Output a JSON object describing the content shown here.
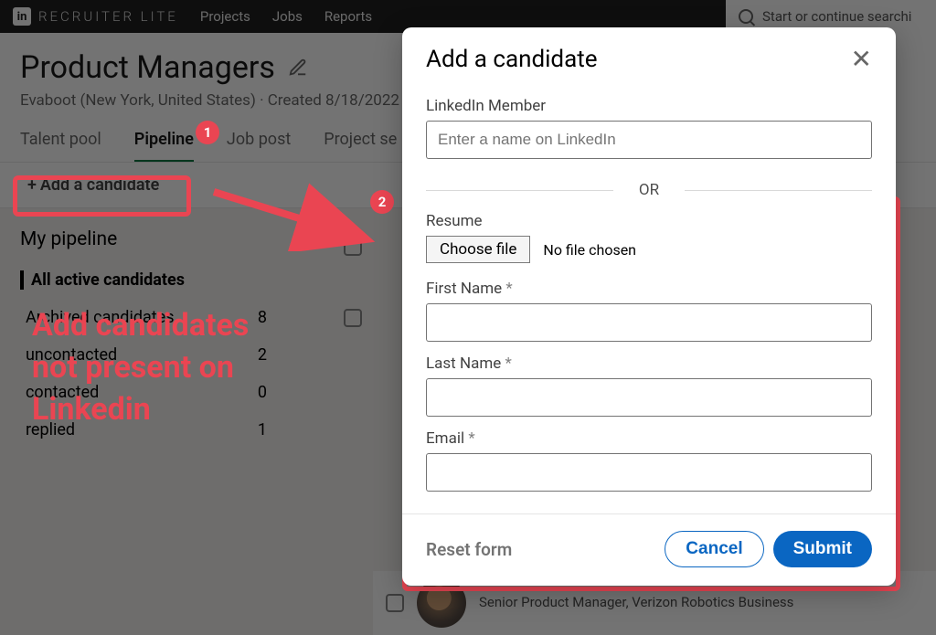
{
  "nav": {
    "logo_badge": "in",
    "logo_text": "RECRUITER LITE",
    "links": [
      "Projects",
      "Jobs",
      "Reports"
    ],
    "search_placeholder": "Start or continue searchi"
  },
  "project": {
    "title": "Product Managers",
    "subtitle": "Evaboot (New York, United States) · Created 8/18/2022",
    "tabs": [
      "Talent pool",
      "Pipeline",
      "Job post",
      "Project se"
    ],
    "active_tab": 1,
    "add_candidate_label": "Add a candidate"
  },
  "pipeline": {
    "heading": "My pipeline",
    "rows": [
      {
        "label": "All active candidates",
        "count": "",
        "bold": true
      },
      {
        "label": "Archived candidates",
        "count": "8"
      },
      {
        "label": "uncontacted",
        "count": "2"
      },
      {
        "label": "contacted",
        "count": "0"
      },
      {
        "label": "replied",
        "count": "1"
      }
    ]
  },
  "modal": {
    "title": "Add a candidate",
    "linkedin_label": "LinkedIn Member",
    "linkedin_placeholder": "Enter a name on LinkedIn",
    "or": "OR",
    "resume_label": "Resume",
    "choose_file": "Choose file",
    "no_file": "No file chosen",
    "first_name_label": "First Name",
    "last_name_label": "Last Name",
    "email_label": "Email",
    "reset": "Reset form",
    "cancel": "Cancel",
    "submit": "Submit"
  },
  "annotations": {
    "badge1": "1",
    "badge2": "2",
    "text": "Add candidates not present on Linkedin"
  },
  "candidate_row": {
    "title_line2": "Senior Product Manager, Verizon Robotics Business"
  }
}
